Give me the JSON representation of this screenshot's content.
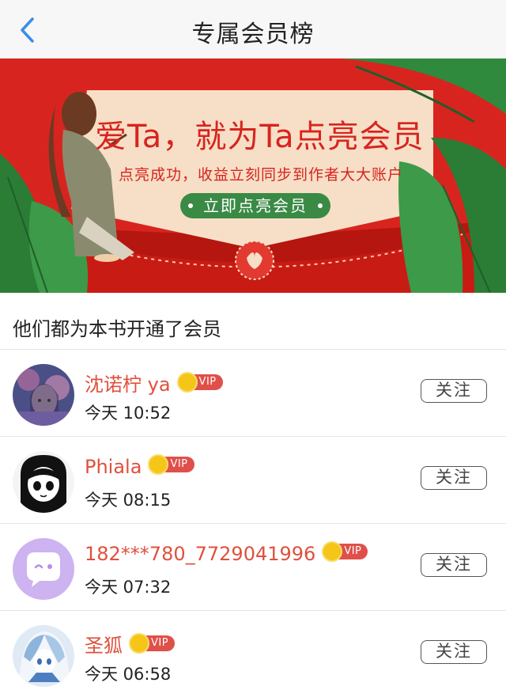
{
  "header": {
    "title": "专属会员榜"
  },
  "banner": {
    "headline": "爱Ta，就为Ta点亮会员",
    "subtitle": "点亮成功，收益立刻同步到作者大大账户",
    "cta_label": "立即点亮会员"
  },
  "section": {
    "title": "他们都为本书开通了会员"
  },
  "members": [
    {
      "name": "沈诺柠 ya",
      "vip_label": "VIP",
      "time": "今天 10:52",
      "follow_label": "关注"
    },
    {
      "name": "Phiala",
      "vip_label": "VIP",
      "time": "今天 08:15",
      "follow_label": "关注"
    },
    {
      "name": "182***780_7729041996",
      "vip_label": "VIP",
      "time": "今天 07:32",
      "follow_label": "关注"
    },
    {
      "name": "圣狐",
      "vip_label": "VIP",
      "time": "今天 06:58",
      "follow_label": "关注"
    }
  ],
  "colors": {
    "accent_blue": "#3a8ee6",
    "banner_red": "#d8241f",
    "name_red": "#e0503c",
    "vip_gold": "#f5c518",
    "cta_green": "#3a8a45"
  },
  "icons": {
    "back": "chevron-left-icon",
    "banner_emblem": "heart-seal-icon",
    "vip_crown": "crown-icon"
  }
}
